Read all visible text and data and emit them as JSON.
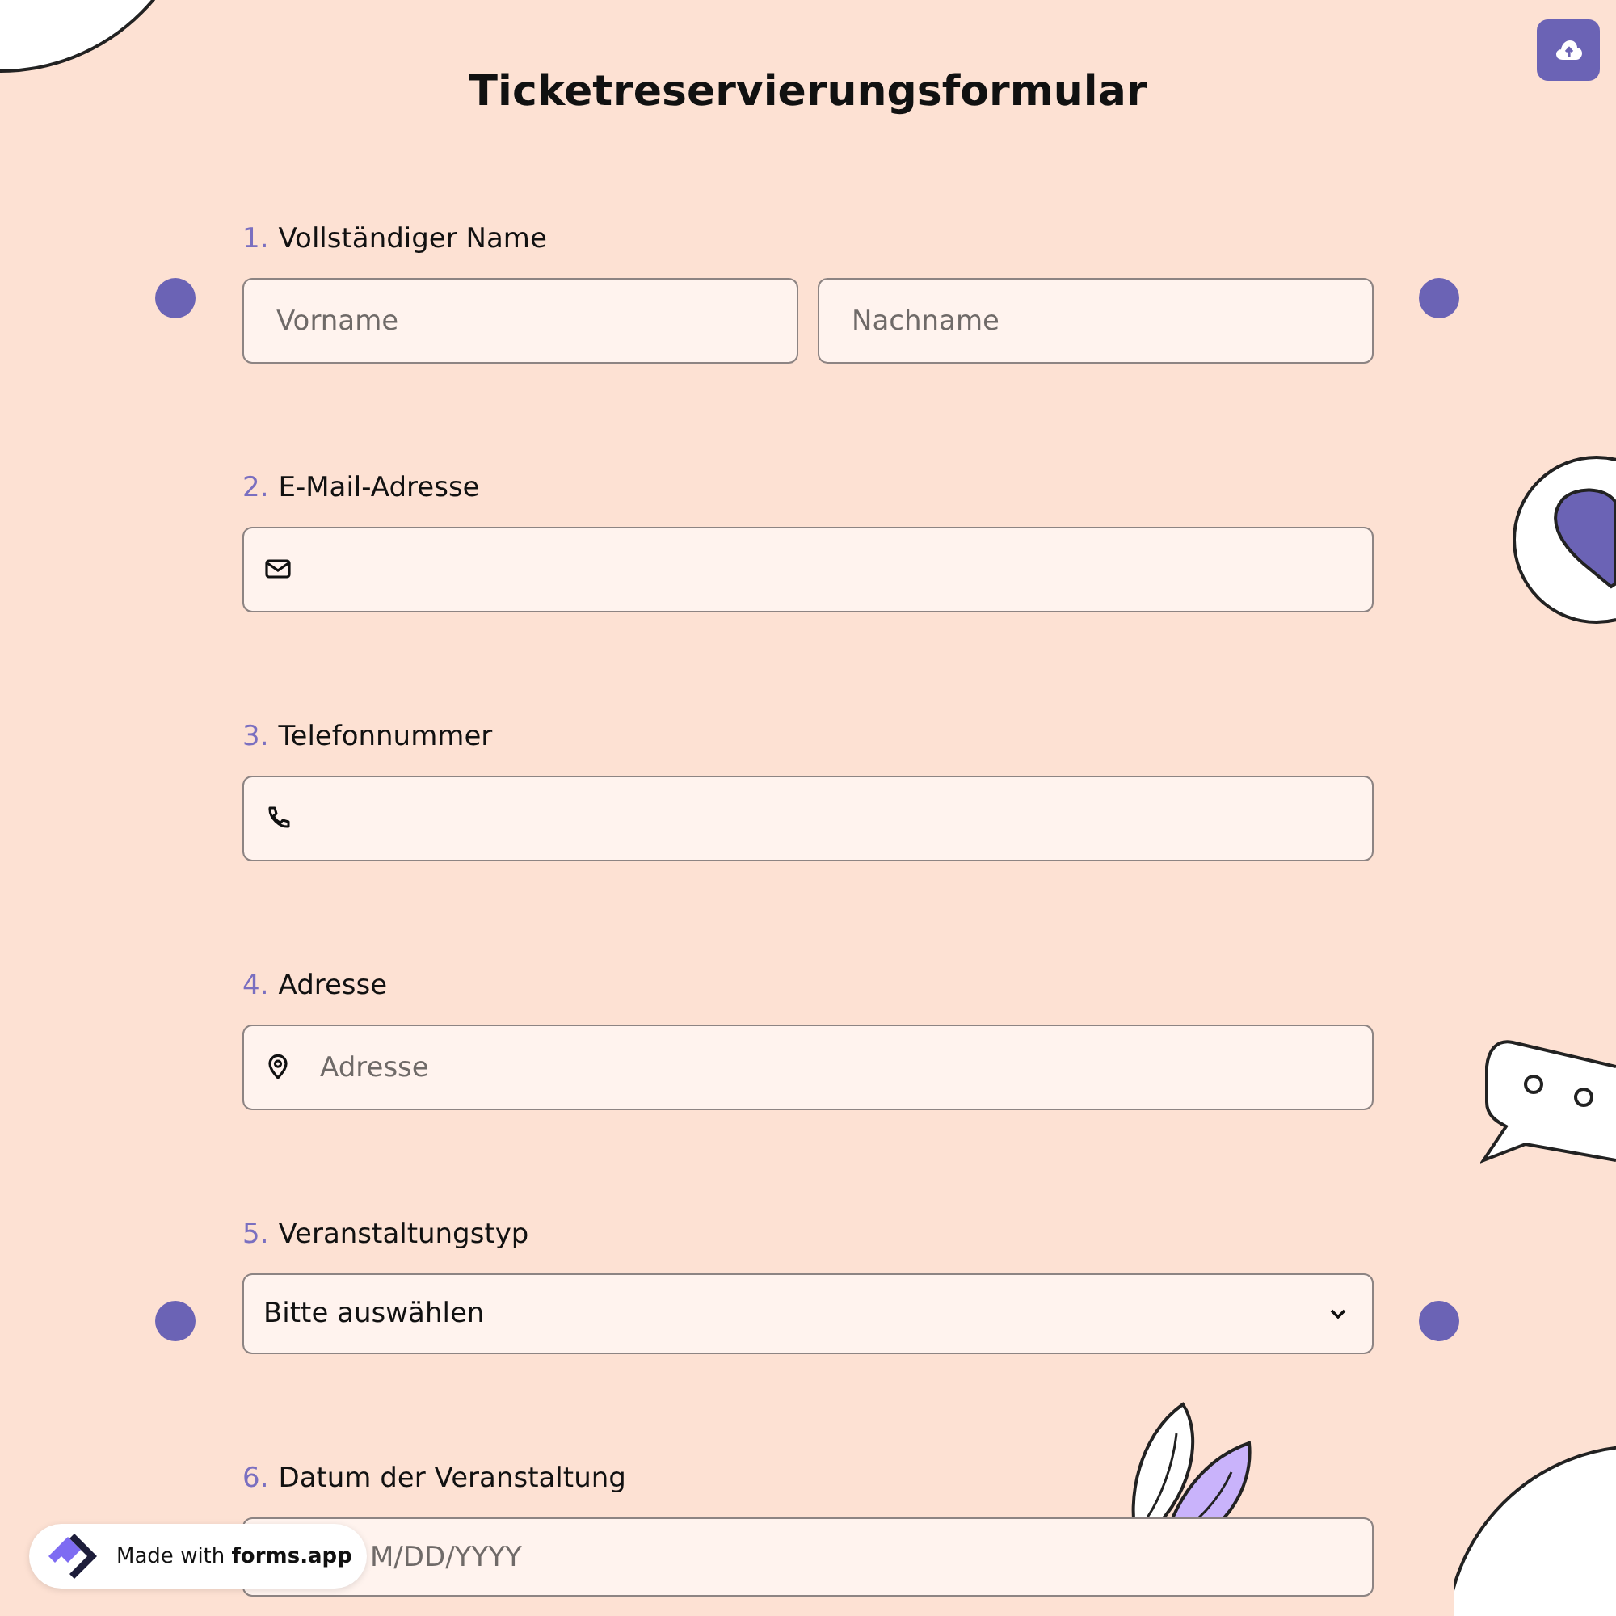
{
  "title": "Ticketreservierungsformular",
  "questions": [
    {
      "number": "1.",
      "label": "Vollständiger Name",
      "kind": "name",
      "fields": [
        {
          "placeholder": "Vorname"
        },
        {
          "placeholder": "Nachname"
        }
      ]
    },
    {
      "number": "2.",
      "label": "E-Mail-Adresse",
      "kind": "email"
    },
    {
      "number": "3.",
      "label": "Telefonnummer",
      "kind": "phone"
    },
    {
      "number": "4.",
      "label": "Adresse",
      "kind": "address",
      "placeholder": "Adresse"
    },
    {
      "number": "5.",
      "label": "Veranstaltungstyp",
      "kind": "select",
      "value": "Bitte auswählen"
    },
    {
      "number": "6.",
      "label": "Datum der Veranstaltung",
      "kind": "date",
      "placeholder": "M/DD/YYYY"
    }
  ],
  "badge": {
    "text": "Made with **forms.app**"
  }
}
